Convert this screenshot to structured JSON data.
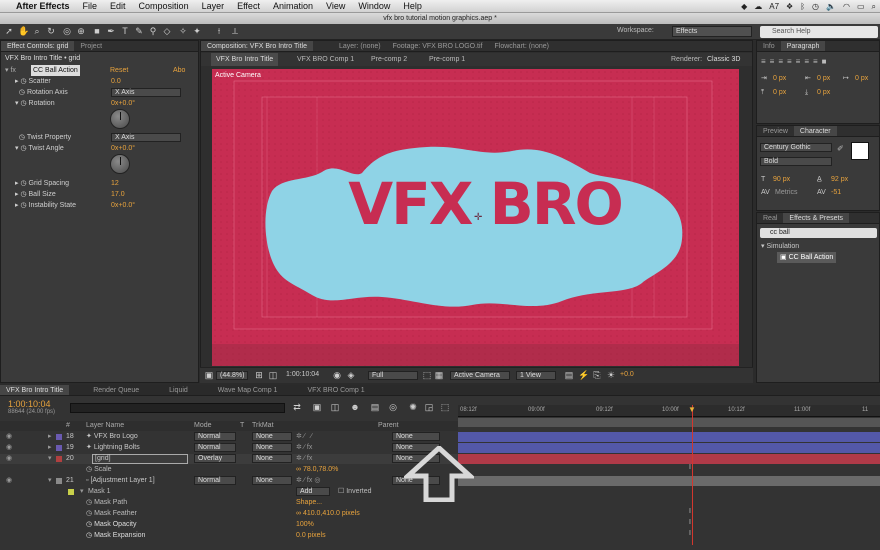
{
  "menubar": {
    "apple": "",
    "app_name": "After Effects",
    "items": [
      "File",
      "Edit",
      "Composition",
      "Layer",
      "Effect",
      "Animation",
      "View",
      "Window",
      "Help"
    ],
    "tray": {
      "adobe": "7",
      "time": "Mon 8:31 PM"
    }
  },
  "window_title": "vfx bro tutorial motion graphics.aep *",
  "toolbar": {
    "workspace_label": "Workspace:",
    "workspace_value": "Effects",
    "search_placeholder": "Search Help"
  },
  "effect_controls": {
    "tab_label": "Effect Controls: grid",
    "tab_project": "Project",
    "layer_title": "VFX Bro Intro Title • grid",
    "effect_name": "CC Ball Action",
    "reset": "Reset",
    "about": "Abo",
    "properties": [
      {
        "name": "Scatter",
        "value": "0.0"
      },
      {
        "name": "Rotation Axis",
        "value": "X Axis",
        "type": "dropdown"
      },
      {
        "name": "Rotation",
        "value": "0x+0.0°",
        "type": "dial"
      },
      {
        "name": "Twist Property",
        "value": "X Axis",
        "type": "dropdown"
      },
      {
        "name": "Twist Angle",
        "value": "0x+0.0°",
        "type": "dial"
      },
      {
        "name": "Grid Spacing",
        "value": "12"
      },
      {
        "name": "Ball Size",
        "value": "17.0"
      },
      {
        "name": "Instability State",
        "value": "0x+0.0°"
      }
    ]
  },
  "composition": {
    "tab_label": "Composition: VFX Bro Intro Title",
    "tab_layer": "Layer: (none)",
    "tab_footage": "Footage: VFX BRO LOGO.tif",
    "tab_flowchart": "Flowchart: (none)",
    "breadcrumbs": [
      "VFX Bro Intro Title",
      "VFX BRO Comp 1",
      "Pre-comp 2",
      "Pre-comp 1"
    ],
    "renderer_label": "Renderer:",
    "renderer_value": "Classic 3D",
    "camera_label": "Active Camera",
    "logo_text": "VFX BRO",
    "footer": {
      "zoom": "(44.8%)",
      "timecode": "1:00:10:04",
      "resolution": "Full",
      "camera": "Active Camera",
      "views": "1 View",
      "exposure": "+0.0"
    }
  },
  "right_panels": {
    "info_tab": "Info",
    "paragraph_tab": "Paragraph",
    "para_values": [
      "0 px",
      "0 px",
      "0 px",
      "0 px",
      "0 px"
    ],
    "preview_tab": "Preview",
    "character_tab": "Character",
    "font": "Century Gothic",
    "style": "Bold",
    "size": "90 px",
    "leading": "92 px",
    "kerning": "Metrics",
    "tracking": "-51",
    "realtab": "Real",
    "fx_tab": "Effects & Presets",
    "fx_search": "cc ball",
    "fx_category": "Simulation",
    "fx_item": "CC Ball Action"
  },
  "timeline": {
    "tabs": [
      "VFX Bro Intro Title",
      "Render Queue",
      "Liquid",
      "Wave Map Comp 1",
      "VFX BRO Comp 1"
    ],
    "timecode": "1:00:10:04",
    "fps": "88644 (24.00 fps)",
    "columns": {
      "num": "#",
      "name": "Layer Name",
      "mode": "Mode",
      "t": "T",
      "trkmat": "TrkMat",
      "parent": "Parent"
    },
    "ruler": [
      "08:12f",
      "09:00f",
      "09:12f",
      "10:00f",
      "10:12f",
      "11:00f",
      "11"
    ],
    "layers": [
      {
        "num": "18",
        "name": "VFX Bro Logo",
        "mode": "Normal",
        "trkmat": "None",
        "parent": "None",
        "color": "#6a5ab0"
      },
      {
        "num": "19",
        "name": "Lightning Bolts",
        "mode": "Normal",
        "trkmat": "None",
        "parent": "None",
        "color": "#6a5ab0"
      },
      {
        "num": "20",
        "name": "[grid]",
        "mode": "Overlay",
        "trkmat": "None",
        "parent": "None",
        "color": "#b04040"
      },
      {
        "num": "21",
        "name": "[Adjustment Layer 1]",
        "mode": "Normal",
        "trkmat": "None",
        "parent": "None",
        "color": "#8a8a8a"
      }
    ],
    "scale_label": "Scale",
    "scale_value": "78.0,78.0%",
    "mask_label": "Mask 1",
    "mask_add": "Add",
    "mask_inverted": "Inverted",
    "mask_props": [
      {
        "name": "Mask Path",
        "value": "Shape..."
      },
      {
        "name": "Mask Feather",
        "value": "410.0,410.0 pixels"
      },
      {
        "name": "Mask Opacity",
        "value": "100%"
      },
      {
        "name": "Mask Expansion",
        "value": "0.0 pixels"
      }
    ]
  },
  "colors": {
    "canvas": "#c72d52",
    "blob": "#8fd3e6",
    "accent": "#e8a33d",
    "track_blue": "#5358a8",
    "track_red": "#b03a48"
  }
}
